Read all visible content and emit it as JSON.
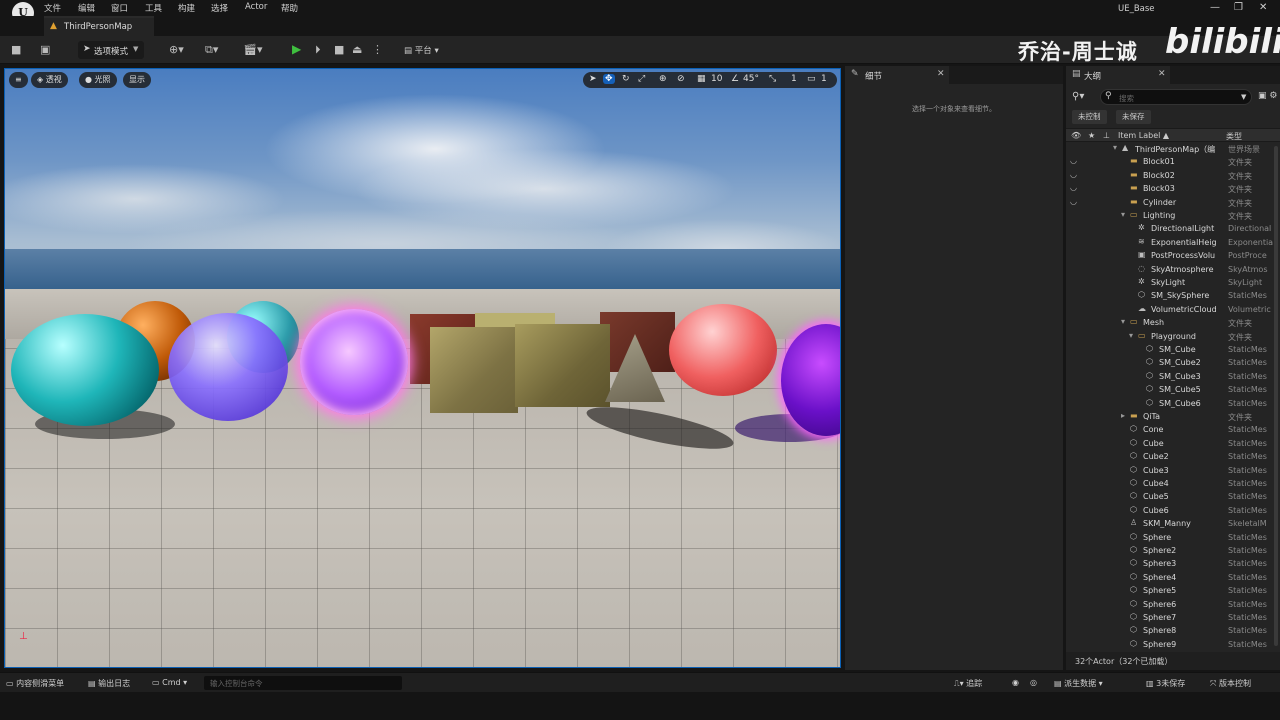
{
  "menu": {
    "items": [
      "文件",
      "编辑",
      "窗口",
      "工具",
      "构建",
      "选择",
      "Actor",
      "帮助"
    ],
    "logo": "U"
  },
  "window": {
    "project": "UE_Base",
    "minimize": "—",
    "restore": "❐",
    "close": "✕"
  },
  "level_tab": {
    "label": "ThirdPersonMap"
  },
  "toolbar": {
    "mode_label": "选项模式",
    "platform_label": "平台"
  },
  "watermark": {
    "author": "乔治-周士诚",
    "site": "bilibili"
  },
  "viewport": {
    "perspective": "透视",
    "lit": "光照",
    "show": "显示",
    "grid_size": "10",
    "rotation_snap": "45°",
    "camera_speed": "1",
    "scale_snap": "1"
  },
  "details": {
    "tab": "细节",
    "empty_hint": "选择一个对象来查看细节。"
  },
  "outliner": {
    "tab": "大纲",
    "search_placeholder": "搜索",
    "chip_uncontrolled": "未控制",
    "chip_unsaved": "未保存",
    "col_label": "Item Label ▲",
    "col_type": "类型",
    "footer": "32个Actor（32个已加载）",
    "rows": [
      {
        "name": "ThirdPersonMap（编",
        "type": "世界场景",
        "indent": 0,
        "icon": "world",
        "eye": false
      },
      {
        "name": "Block01",
        "type": "文件夹",
        "indent": 1,
        "icon": "folder",
        "eye": true
      },
      {
        "name": "Block02",
        "type": "文件夹",
        "indent": 1,
        "icon": "folder",
        "eye": true
      },
      {
        "name": "Block03",
        "type": "文件夹",
        "indent": 1,
        "icon": "folder",
        "eye": true
      },
      {
        "name": "Cylinder",
        "type": "文件夹",
        "indent": 1,
        "icon": "folder",
        "eye": true
      },
      {
        "name": "Lighting",
        "type": "文件夹",
        "indent": 1,
        "icon": "folder-open",
        "eye": false
      },
      {
        "name": "DirectionalLight",
        "type": "Directional",
        "indent": 2,
        "icon": "light",
        "eye": false
      },
      {
        "name": "ExponentialHeig",
        "type": "Exponentia",
        "indent": 2,
        "icon": "fog",
        "eye": false
      },
      {
        "name": "PostProcessVolu",
        "type": "PostProce",
        "indent": 2,
        "icon": "volume",
        "eye": false
      },
      {
        "name": "SkyAtmosphere",
        "type": "SkyAtmos",
        "indent": 2,
        "icon": "sky",
        "eye": false
      },
      {
        "name": "SkyLight",
        "type": "SkyLight",
        "indent": 2,
        "icon": "light",
        "eye": false
      },
      {
        "name": "SM_SkySphere",
        "type": "StaticMes",
        "indent": 2,
        "icon": "mesh",
        "eye": false
      },
      {
        "name": "VolumetricCloud",
        "type": "Volumetric",
        "indent": 2,
        "icon": "cloud",
        "eye": false
      },
      {
        "name": "Mesh",
        "type": "文件夹",
        "indent": 1,
        "icon": "folder-open",
        "eye": false
      },
      {
        "name": "Playground",
        "type": "文件夹",
        "indent": 2,
        "icon": "folder-open",
        "eye": false
      },
      {
        "name": "SM_Cube",
        "type": "StaticMes",
        "indent": 3,
        "icon": "mesh",
        "eye": false
      },
      {
        "name": "SM_Cube2",
        "type": "StaticMes",
        "indent": 3,
        "icon": "mesh",
        "eye": false
      },
      {
        "name": "SM_Cube3",
        "type": "StaticMes",
        "indent": 3,
        "icon": "mesh",
        "eye": false
      },
      {
        "name": "SM_Cube5",
        "type": "StaticMes",
        "indent": 3,
        "icon": "mesh",
        "eye": false
      },
      {
        "name": "SM_Cube6",
        "type": "StaticMes",
        "indent": 3,
        "icon": "mesh",
        "eye": false
      },
      {
        "name": "QiTa",
        "type": "文件夹",
        "indent": 1,
        "icon": "folder",
        "eye": false
      },
      {
        "name": "Cone",
        "type": "StaticMes",
        "indent": 1,
        "icon": "mesh",
        "eye": false
      },
      {
        "name": "Cube",
        "type": "StaticMes",
        "indent": 1,
        "icon": "mesh",
        "eye": false
      },
      {
        "name": "Cube2",
        "type": "StaticMes",
        "indent": 1,
        "icon": "mesh",
        "eye": false
      },
      {
        "name": "Cube3",
        "type": "StaticMes",
        "indent": 1,
        "icon": "mesh",
        "eye": false
      },
      {
        "name": "Cube4",
        "type": "StaticMes",
        "indent": 1,
        "icon": "mesh",
        "eye": false
      },
      {
        "name": "Cube5",
        "type": "StaticMes",
        "indent": 1,
        "icon": "mesh",
        "eye": false
      },
      {
        "name": "Cube6",
        "type": "StaticMes",
        "indent": 1,
        "icon": "mesh",
        "eye": false
      },
      {
        "name": "SKM_Manny",
        "type": "SkeletalM",
        "indent": 1,
        "icon": "skeletal",
        "eye": false
      },
      {
        "name": "Sphere",
        "type": "StaticMes",
        "indent": 1,
        "icon": "mesh",
        "eye": false
      },
      {
        "name": "Sphere2",
        "type": "StaticMes",
        "indent": 1,
        "icon": "mesh",
        "eye": false
      },
      {
        "name": "Sphere3",
        "type": "StaticMes",
        "indent": 1,
        "icon": "mesh",
        "eye": false
      },
      {
        "name": "Sphere4",
        "type": "StaticMes",
        "indent": 1,
        "icon": "mesh",
        "eye": false
      },
      {
        "name": "Sphere5",
        "type": "StaticMes",
        "indent": 1,
        "icon": "mesh",
        "eye": false
      },
      {
        "name": "Sphere6",
        "type": "StaticMes",
        "indent": 1,
        "icon": "mesh",
        "eye": false
      },
      {
        "name": "Sphere7",
        "type": "StaticMes",
        "indent": 1,
        "icon": "mesh",
        "eye": false
      },
      {
        "name": "Sphere8",
        "type": "StaticMes",
        "indent": 1,
        "icon": "mesh",
        "eye": false
      },
      {
        "name": "Sphere9",
        "type": "StaticMes",
        "indent": 1,
        "icon": "mesh",
        "eye": false
      }
    ]
  },
  "statusbar": {
    "content_drawer": "内容侧滑菜单",
    "output_log": "输出日志",
    "cmd": "Cmd",
    "cmd_placeholder": "输入控制台命令",
    "trace": "追踪",
    "derived_data": "派生数据",
    "unsaved": "3未保存",
    "source_control": "版本控制"
  },
  "colors": {
    "accent": "#1560b8",
    "play": "#3fbf3f",
    "folder": "#c9a050"
  }
}
